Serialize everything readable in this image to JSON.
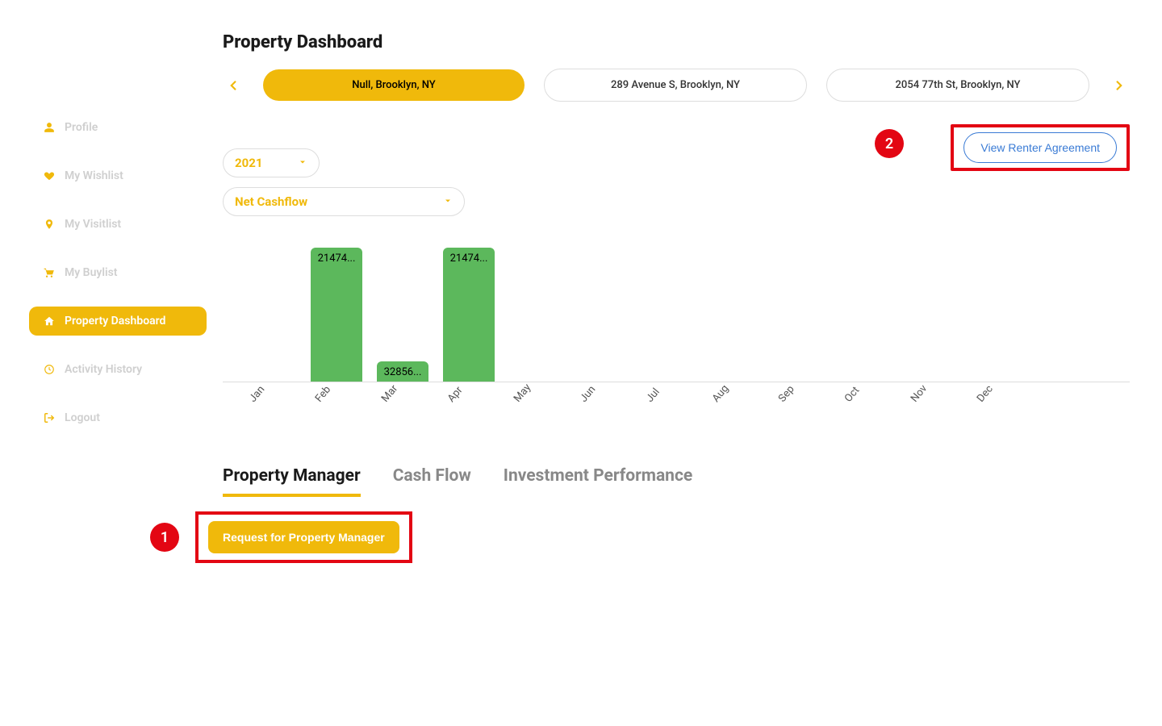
{
  "sidebar": {
    "items": [
      {
        "label": "Profile",
        "icon": "user-icon",
        "active": false
      },
      {
        "label": "My Wishlist",
        "icon": "heart-icon",
        "active": false
      },
      {
        "label": "My Visitlist",
        "icon": "pin-icon",
        "active": false
      },
      {
        "label": "My Buylist",
        "icon": "cart-icon",
        "active": false
      },
      {
        "label": "Property Dashboard",
        "icon": "home-icon",
        "active": true
      },
      {
        "label": "Activity History",
        "icon": "clock-icon",
        "active": false
      },
      {
        "label": "Logout",
        "icon": "logout-icon",
        "active": false
      }
    ]
  },
  "header": {
    "title": "Property Dashboard"
  },
  "properties": {
    "items": [
      {
        "label": "Null, Brooklyn, NY",
        "active": true
      },
      {
        "label": "289 Avenue S, Brooklyn, NY",
        "active": false
      },
      {
        "label": "2054 77th St, Brooklyn, NY",
        "active": false
      }
    ]
  },
  "agreement": {
    "button_label": "View Renter Agreement",
    "callout_number": "2"
  },
  "filters": {
    "year": "2021",
    "metric": "Net Cashflow"
  },
  "chart_data": {
    "type": "bar",
    "categories": [
      "Jan",
      "Feb",
      "Mar",
      "Apr",
      "May",
      "Jun",
      "Jul",
      "Aug",
      "Sep",
      "Oct",
      "Nov",
      "Dec"
    ],
    "values": [
      null,
      21474,
      3285,
      21474,
      null,
      null,
      null,
      null,
      null,
      null,
      null,
      null
    ],
    "display_labels": [
      "",
      "21474...",
      "32856...",
      "21474...",
      "",
      "",
      "",
      "",
      "",
      "",
      "",
      ""
    ],
    "title": "",
    "xlabel": "",
    "ylabel": "",
    "ylim": [
      0,
      22000
    ],
    "color": "#5cb85c"
  },
  "tabs": {
    "items": [
      {
        "label": "Property Manager",
        "active": true
      },
      {
        "label": "Cash Flow",
        "active": false
      },
      {
        "label": "Investment Performance",
        "active": false
      }
    ]
  },
  "request": {
    "button_label": "Request for Property Manager",
    "callout_number": "1"
  }
}
